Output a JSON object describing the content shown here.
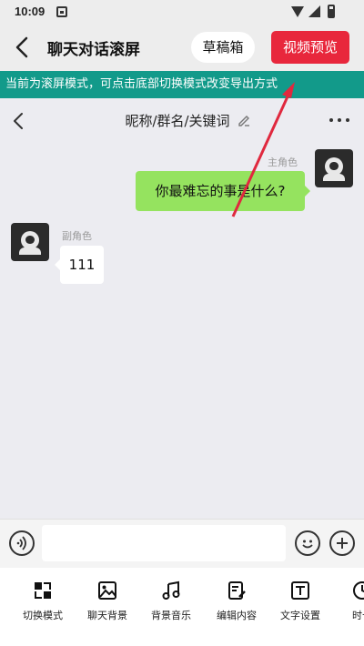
{
  "status_bar": {
    "time": "10:09"
  },
  "header": {
    "title": "聊天对话滚屏",
    "draft_label": "草稿箱",
    "preview_label": "视频预览"
  },
  "notice": {
    "text": "当前为滚屏模式，可点击底部切换模式改变导出方式"
  },
  "chat_header": {
    "name": "昵称/群名/关键词"
  },
  "messages": [
    {
      "role": "主角色",
      "text": "你最难忘的事是什么?",
      "side": "right"
    },
    {
      "role": "副角色",
      "text": "111",
      "side": "left"
    }
  ],
  "toolbar": {
    "items": [
      {
        "label": "切换模式",
        "icon": "switch-mode-icon"
      },
      {
        "label": "聊天背景",
        "icon": "image-icon"
      },
      {
        "label": "背景音乐",
        "icon": "music-icon"
      },
      {
        "label": "编辑内容",
        "icon": "edit-icon"
      },
      {
        "label": "文字设置",
        "icon": "text-icon"
      },
      {
        "label": "时长",
        "icon": "clock-icon"
      }
    ]
  },
  "colors": {
    "accent_red": "#e8273c",
    "notice_teal": "#129a8a",
    "bubble_green": "#95e35f",
    "arrow_red": "#e0283e"
  }
}
